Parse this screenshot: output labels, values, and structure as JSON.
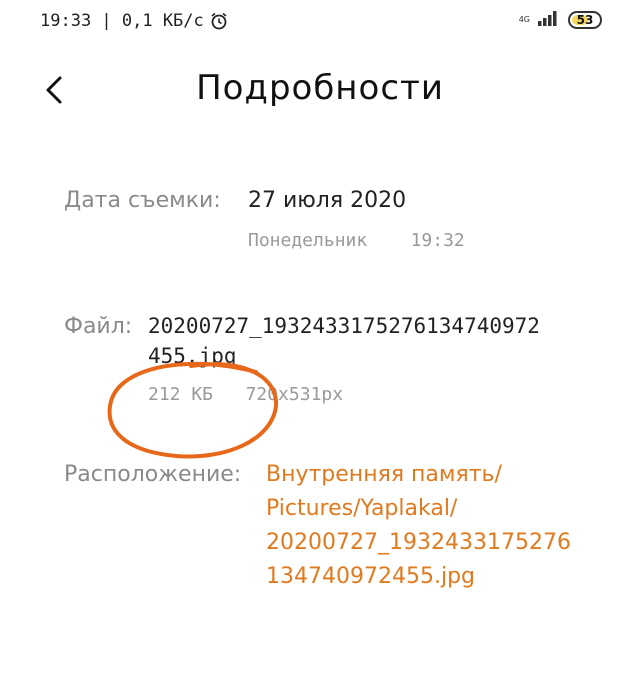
{
  "status_bar": {
    "time_speed": "19:33 | 0,1 КБ/с",
    "network_top": "4G",
    "network_bottom": "il",
    "battery": "53",
    "battery_level_percent": 53
  },
  "header": {
    "title": "Подробности",
    "back_icon": "chevron-left-icon"
  },
  "details": {
    "date_label": "Дата съемки:",
    "date_value": "27 июля 2020",
    "weekday": "Понедельник",
    "time": "19:32",
    "file_label": "Файл:",
    "file_line1": "20200727_193243317527613474097 2",
    "file_line1_exact": "202007 27_1932433175276134740972",
    "file_name_line1": "20200727_1932433175276134740972",
    "file_name_line2": "455.jpg",
    "file_size": "212 КБ",
    "resolution": "720x531px",
    "location_label": "Расположение:",
    "location_lines": [
      "Внутренняя память/",
      "Pictures/Yaplakal/",
      "20200727_1932433175276",
      "134740972455.jpg"
    ]
  },
  "colors": {
    "accent": "#e07a1f",
    "annotation": "#e8681a",
    "label": "#8a8a8a"
  }
}
